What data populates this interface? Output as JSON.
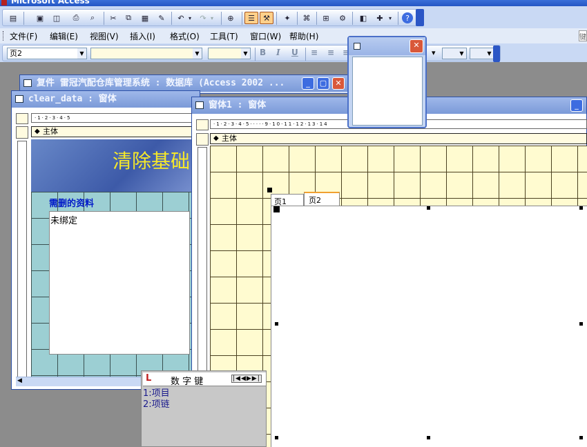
{
  "app": {
    "title": "Microsoft Access"
  },
  "menus": [
    "文件(F)",
    "编辑(E)",
    "视图(V)",
    "插入(I)",
    "格式(O)",
    "工具(T)",
    "窗口(W)",
    "帮助(H)"
  ],
  "toolbar_icons": [
    "view-icon",
    "save-icon",
    "search-db-icon",
    "print-icon",
    "print-preview-icon",
    "cut-icon",
    "copy-icon",
    "paste-icon",
    "format-painter-icon",
    "undo-icon",
    "redo-icon",
    "hyperlink-icon",
    "field-list-icon",
    "toolbox-icon",
    "autoformat-icon",
    "code-icon",
    "properties-icon",
    "build-icon",
    "database-window-icon",
    "new-object-icon",
    "help-icon"
  ],
  "format_bar": {
    "object_combo": "页2",
    "bold": "B",
    "italic": "I",
    "underline": "U"
  },
  "db_window": {
    "title": "复件 雷冠汽配仓库管理系统 : 数据库 (Access 2002 ..."
  },
  "clear_form": {
    "title": "clear_data : 窗体",
    "section": "主体",
    "heading": "清除基础",
    "list_label": "需删的资料",
    "list_value": "未绑定"
  },
  "form1": {
    "title": "窗体1 : 窗体",
    "section": "主体",
    "tabs": [
      "页1",
      "页2"
    ]
  },
  "ruler": {
    "clear": "·1·2·3·4·5",
    "form1": "·1·2·3·4·5·····9·10·11·12·13·14"
  },
  "popup": {
    "title": "数 字 键",
    "items": [
      "1:项目",
      "2:项链"
    ]
  },
  "colors": {
    "accent": "#3a6fd8",
    "form_heading": "#f5e82a",
    "label_blue": "#0018c8"
  }
}
